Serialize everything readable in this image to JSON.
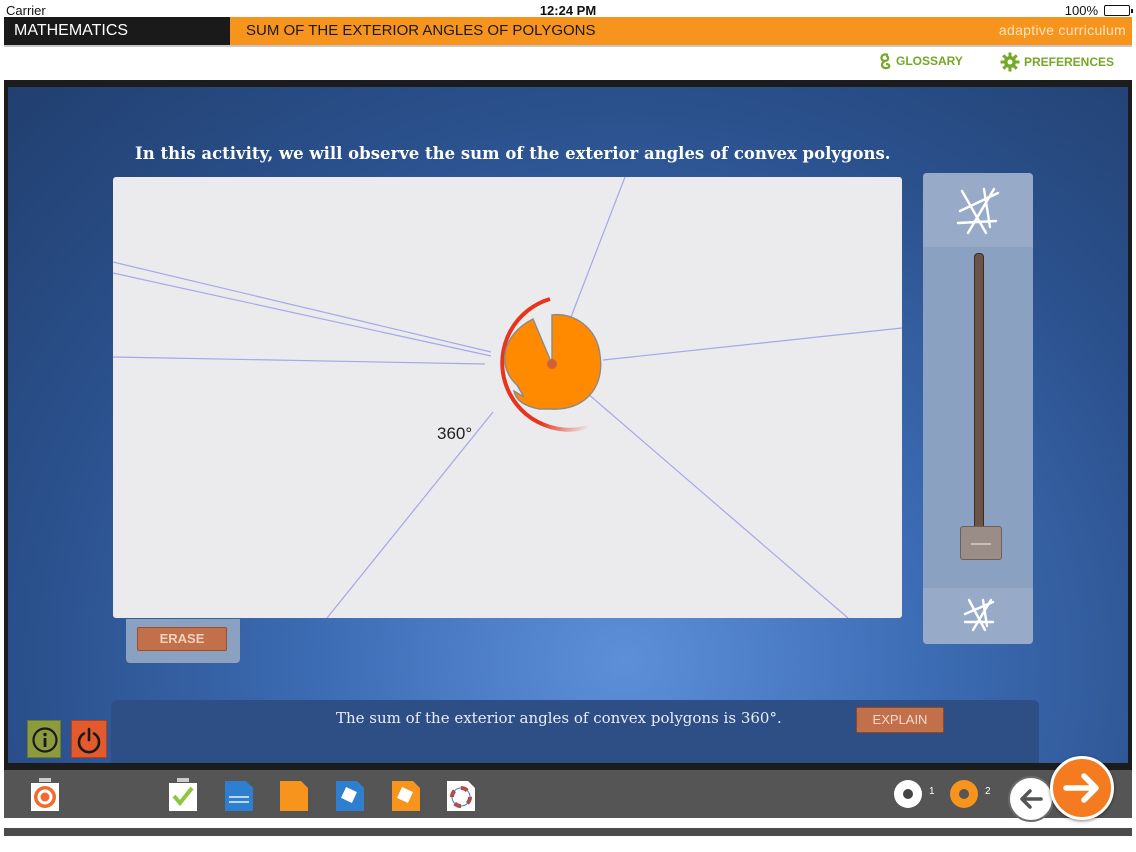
{
  "status_bar": {
    "carrier": "Carrier",
    "time": "12:24 PM",
    "battery": "100%"
  },
  "title_bar": {
    "subject": "MATHEMATICS",
    "lesson": "SUM OF THE EXTERIOR ANGLES OF POLYGONS",
    "brand": "adaptive curriculum"
  },
  "links": {
    "glossary": "GLOSSARY",
    "preferences": "PREFERENCES"
  },
  "activity": {
    "instruction": "In this activity, we will observe the sum of the exterior angles of convex polygons.",
    "angle_readout": "360°",
    "erase_label": "ERASE",
    "slider_level": 0.0
  },
  "conclusion": {
    "text": "The sum of the exterior angles of convex polygons is 360°.",
    "explain_label": "EXPLAIN"
  },
  "toolbar": {
    "pages": [
      {
        "number": "1"
      },
      {
        "number": "2"
      }
    ],
    "icons": [
      "target-icon",
      "checklist-icon",
      "blue-document-icon",
      "orange-document-icon",
      "blue-puzzle-icon",
      "orange-puzzle-icon",
      "lifebuoy-icon"
    ]
  },
  "colors": {
    "accent": "#f7941d",
    "stage": "#3c6cb4",
    "button": "#c2704a",
    "shape": "#ff8a00"
  }
}
